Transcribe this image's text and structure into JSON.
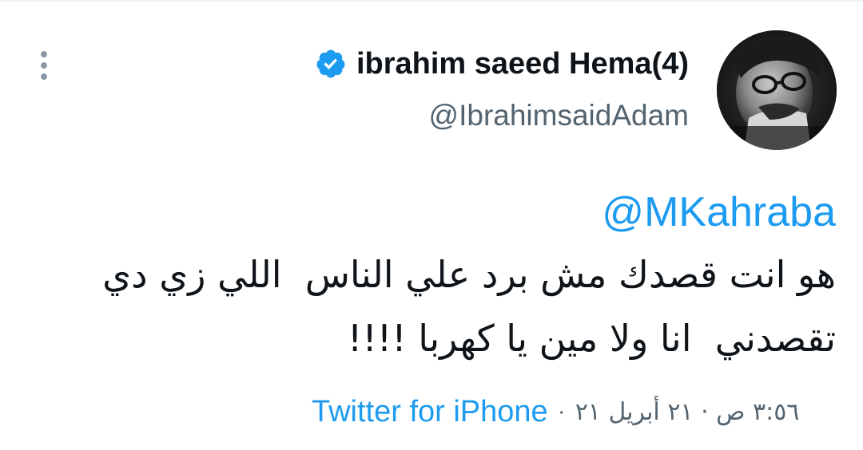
{
  "author": {
    "display_name": "ibrahim saeed Hema(4)",
    "handle": "@IbrahimsaidAdam",
    "verified": true,
    "avatar_icon": "profile-photo"
  },
  "tweet": {
    "mention": "@MKahraba",
    "lines": [
      "هو انت قصدك مش برد علي الناس  اللي زي دي",
      "تقصدني  انا ولا مين يا كهربا !!!!"
    ],
    "timestamp": "٣:٥٦ ص · ٢١ أبريل ٢١",
    "separator": "·",
    "source": "Twitter for iPhone"
  },
  "icons": {
    "more": "more-vertical-icon",
    "verified": "verified-badge-icon"
  },
  "colors": {
    "accent": "#1d9bf0",
    "text": "#0f1419",
    "secondary": "#536471"
  }
}
